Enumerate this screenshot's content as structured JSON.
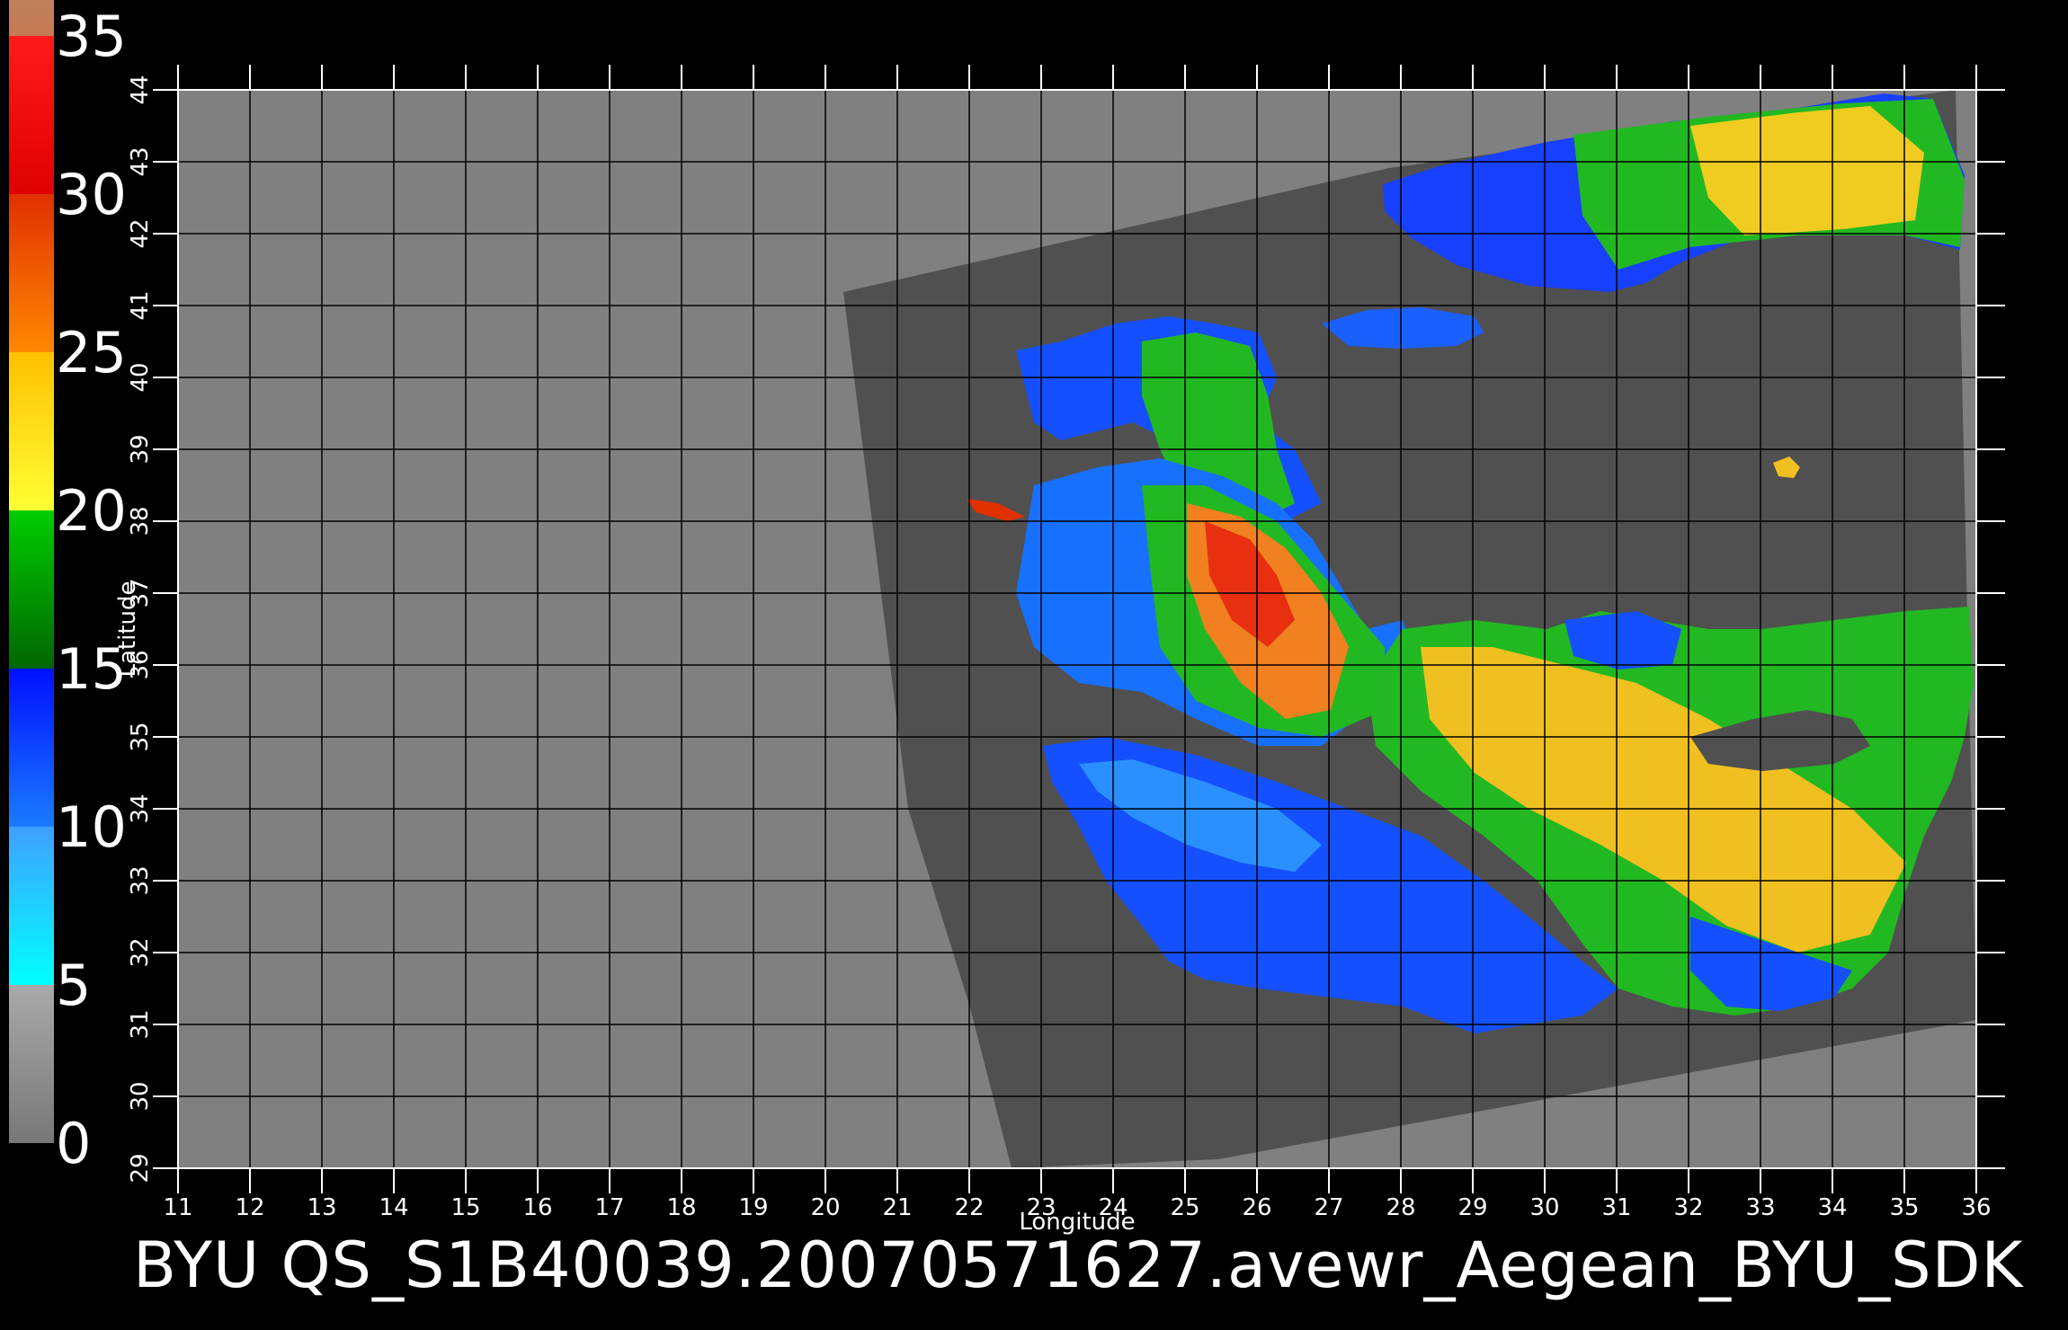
{
  "colorbar": {
    "labels": [
      "35",
      "30",
      "25",
      "20",
      "15",
      "10",
      "5",
      "0"
    ],
    "values": [
      35,
      30,
      25,
      20,
      15,
      10,
      5,
      0
    ],
    "segments": [
      {
        "from": 0,
        "to": 5,
        "color_top": "#a9a9a9",
        "color_bottom": "#777777"
      },
      {
        "from": 5,
        "to": 10,
        "color_top": "#3fa0ff",
        "color_bottom": "#00ffff"
      },
      {
        "from": 10,
        "to": 15,
        "color_top": "#0010ff",
        "color_bottom": "#1a7bff"
      },
      {
        "from": 15,
        "to": 20,
        "color_top": "#00cc00",
        "color_bottom": "#006600"
      },
      {
        "from": 20,
        "to": 25,
        "color_top": "#ffc000",
        "color_bottom": "#ffff33"
      },
      {
        "from": 25,
        "to": 30,
        "color_top": "#e03000",
        "color_bottom": "#ff8800"
      },
      {
        "from": 30,
        "to": 35,
        "color_top": "#ff1a1a",
        "color_bottom": "#e00000"
      },
      {
        "from": 35,
        "to": 37,
        "color_top": "#b9865f",
        "color_bottom": "#c77a55"
      }
    ]
  },
  "map": {
    "lon_range": [
      11,
      36
    ],
    "lat_range": [
      29,
      44
    ],
    "lon_ticks": [
      "11",
      "12",
      "13",
      "14",
      "15",
      "16",
      "17",
      "18",
      "19",
      "20",
      "21",
      "22",
      "23",
      "24",
      "25",
      "26",
      "27",
      "28",
      "29",
      "30",
      "31",
      "32",
      "33",
      "34",
      "35",
      "36"
    ],
    "lat_ticks": [
      "29",
      "30",
      "31",
      "32",
      "33",
      "34",
      "35",
      "36",
      "37",
      "38",
      "39",
      "40",
      "41",
      "42",
      "43",
      "44"
    ],
    "xlabel": "Longitude",
    "ylabel": "Latitude",
    "background_color": "#808080",
    "swath_color": "#505050",
    "grid_color": "#000000"
  },
  "footer": {
    "text": "BYU  QS_S1B40039.20070571627.avewr_Aegean_BYU_SDK"
  }
}
